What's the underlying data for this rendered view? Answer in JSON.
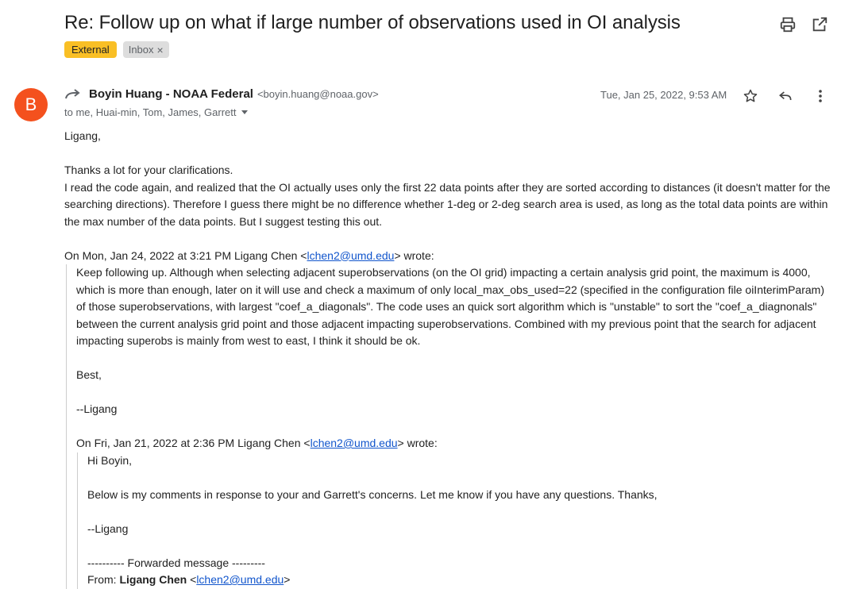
{
  "subject": "Re: Follow up on what if large number of observations used in OI analysis",
  "labels": {
    "external": "External",
    "inbox": "Inbox",
    "remove": "×"
  },
  "sender": {
    "initial": "B",
    "name": "Boyin Huang - NOAA Federal",
    "email": "<boyin.huang@noaa.gov>",
    "recipients": "to me, Huai-min, Tom, James, Garrett",
    "date": "Tue, Jan 25, 2022, 9:53 AM"
  },
  "colors": {
    "avatar": "#f4511e",
    "external_label": "#f9bf25",
    "link": "#1155cc"
  },
  "icons": [
    "print-icon",
    "open-new-window-icon",
    "reply-arrow-icon",
    "star-icon",
    "reply-icon",
    "more-vert-icon"
  ],
  "body": {
    "greeting": "Ligang,",
    "p1": "Thanks a lot for your clarifications.",
    "p2": "I read the code again, and realized that the OI actually uses only the first 22 data points after they are sorted according to distances (it doesn't matter for the searching directions). Therefore I guess there might be no difference whether 1-deg or 2-deg search area is used, as long as the total data points are within the max number of the data points. But I suggest testing this out."
  },
  "quote1": {
    "intro_pre": "On Mon, Jan 24, 2022 at 3:21 PM Ligang Chen <",
    "email": "lchen2@umd.edu",
    "intro_post": "> wrote:",
    "text": "Keep following up. Although when selecting adjacent superobservations (on the OI grid) impacting a certain analysis grid point, the maximum is 4000, which is more than enough, later on it will use and check a maximum of only local_max_obs_used=22 (specified in the configuration file oiInterimParam) of those superobservations, with largest \"coef_a_diagonals\". The code uses an quick sort algorithm which is \"unstable\" to sort the \"coef_a_diagnonals\" between the current analysis grid point and those adjacent impacting superobservations. Combined with my previous point that the search for adjacent impacting superobs is mainly from west to east, I think it should be ok.",
    "closing": "Best,",
    "signature": "--Ligang"
  },
  "quote2": {
    "intro_pre": "On Fri, Jan 21, 2022 at 2:36 PM Ligang Chen <",
    "email": "lchen2@umd.edu",
    "intro_post": "> wrote:",
    "greeting": "Hi Boyin,",
    "text": "Below is my comments in response to your and Garrett's concerns. Let me know if you have any questions. Thanks,",
    "signature": "--Ligang",
    "forwarded": "---------- Forwarded message ---------",
    "from_label": "From: ",
    "from_name": "Ligang Chen",
    "from_pre": " <",
    "from_email": "lchen2@umd.edu",
    "from_post": ">"
  }
}
